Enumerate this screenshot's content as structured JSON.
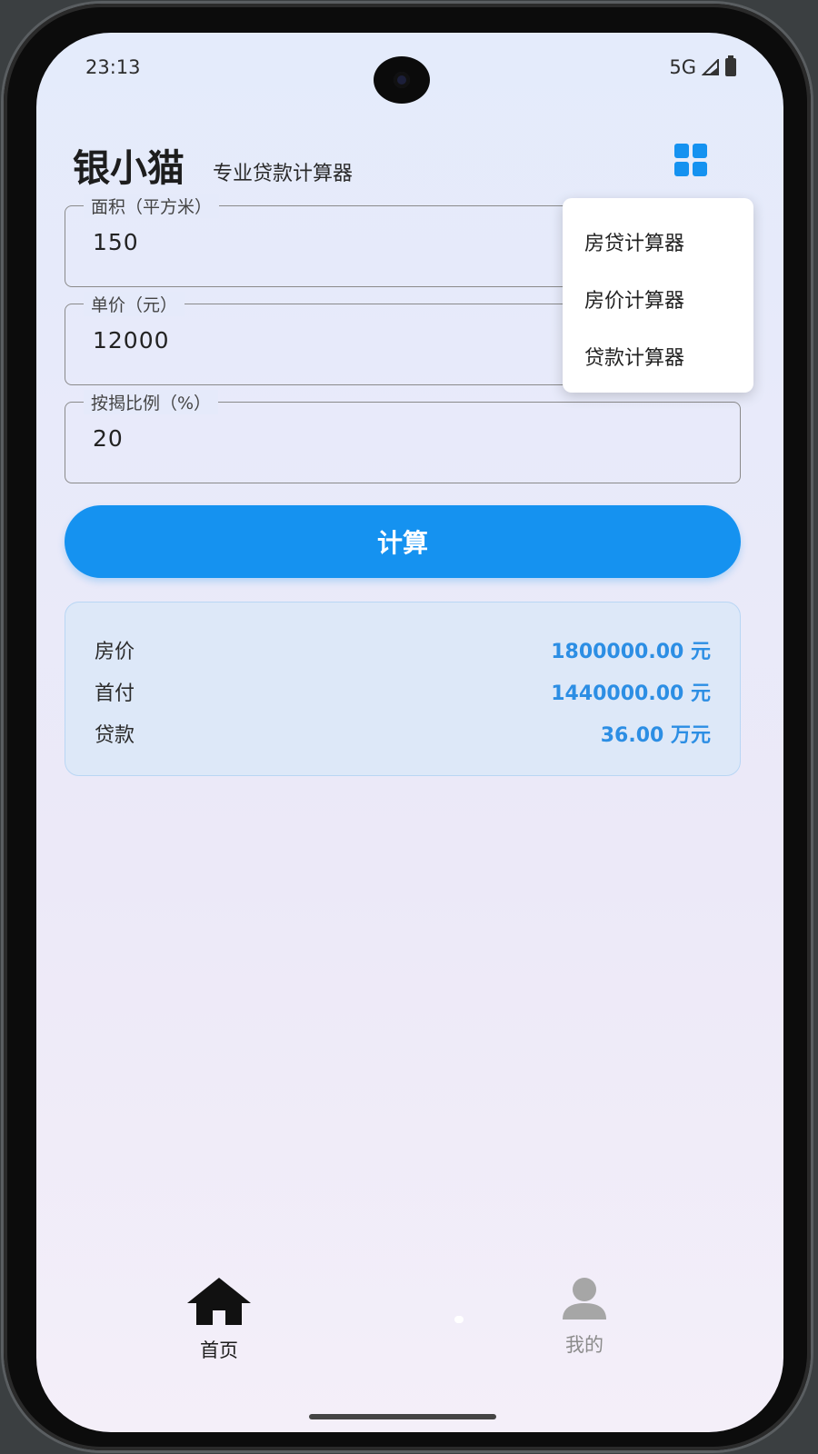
{
  "status_bar": {
    "time": "23:13",
    "network": "5G"
  },
  "header": {
    "brand": "银小猫",
    "subtitle": "专业贷款计算器"
  },
  "form": {
    "area": {
      "label": "面积（平方米）",
      "value": "150"
    },
    "unit_price": {
      "label": "单价（元）",
      "value": "12000"
    },
    "ratio": {
      "label": "按揭比例（%）",
      "value": "20"
    },
    "submit_label": "计算"
  },
  "results": [
    {
      "label": "房价",
      "value": "1800000.00 元"
    },
    {
      "label": "首付",
      "value": "1440000.00 元"
    },
    {
      "label": "贷款",
      "value": "36.00 万元"
    }
  ],
  "menu": {
    "items": [
      "房贷计算器",
      "房价计算器",
      "贷款计算器"
    ]
  },
  "tabbar": {
    "home_label": "首页",
    "mine_label": "我的"
  },
  "colors": {
    "accent": "#1592f0",
    "value_text": "#2c8ee4",
    "card_bg": "#dde8f8"
  }
}
